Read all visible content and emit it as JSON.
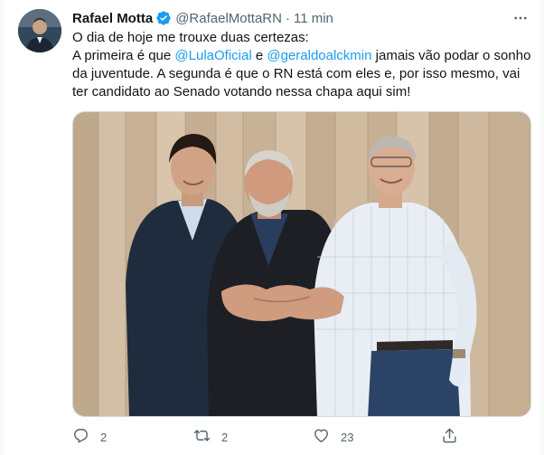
{
  "tweet": {
    "author_name": "Rafael Motta",
    "handle": "@RafaelMottaRN",
    "separator": "·",
    "time": "11 min",
    "text": {
      "line1": "O dia de hoje me trouxe duas certezas:",
      "line2_a": "A primeira é que ",
      "mention1": "@LulaOficial",
      "line2_b": " e ",
      "mention2": "@geraldoalckmin",
      "line2_c": " jamais vão podar o sonho",
      "line3": "da juventude. A segunda é que o RN está com eles e, por isso mesmo, vai",
      "line4": "ter candidato ao Senado votando nessa chapa aqui sim!"
    },
    "stats": {
      "replies": "2",
      "retweets": "2",
      "likes": "23"
    }
  },
  "icons": {
    "verified": "verified-badge-icon",
    "more": "more-options-icon",
    "reply": "reply-icon",
    "retweet": "retweet-icon",
    "like": "heart-icon",
    "share": "share-icon"
  },
  "colors": {
    "accent": "#1d9bf0",
    "secondary_text": "#536471",
    "primary_text": "#0f1419"
  }
}
